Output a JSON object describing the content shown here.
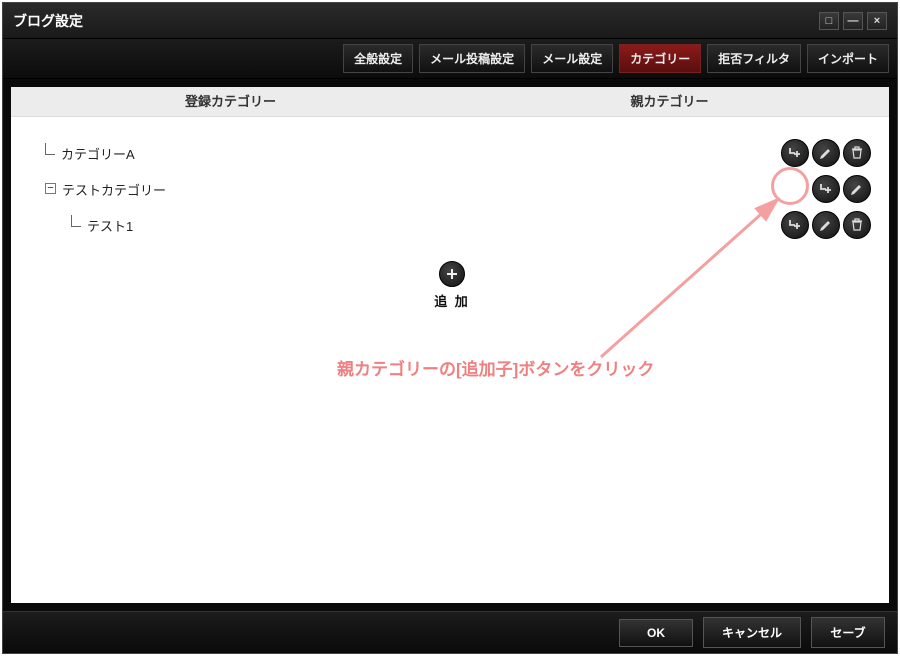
{
  "window": {
    "title": "ブログ設定"
  },
  "tabs": [
    {
      "label": "全般設定",
      "active": false
    },
    {
      "label": "メール投稿設定",
      "active": false
    },
    {
      "label": "メール設定",
      "active": false
    },
    {
      "label": "カテゴリー",
      "active": true
    },
    {
      "label": "拒否フィルタ",
      "active": false
    },
    {
      "label": "インポート",
      "active": false
    }
  ],
  "columns": {
    "left": "登録カテゴリー",
    "right": "親カテゴリー"
  },
  "tree": {
    "rows": [
      {
        "label": "カテゴリーA",
        "indent": 1,
        "has_expander": false,
        "actions": [
          "add-child",
          "edit",
          "delete"
        ]
      },
      {
        "label": "テストカテゴリー",
        "indent": 1,
        "has_expander": true,
        "expander": "−",
        "actions": [
          "add-child",
          "edit"
        ]
      },
      {
        "label": "テスト1",
        "indent": 2,
        "has_expander": false,
        "actions": [
          "add-child",
          "edit",
          "delete"
        ]
      }
    ]
  },
  "add_button": {
    "label": "追 加"
  },
  "annotation": {
    "text": "親カテゴリーの[追加子]ボタンをクリック"
  },
  "footer": {
    "ok": "OK",
    "cancel": "キャンセル",
    "save": "セーブ"
  },
  "icons": {
    "add_child": "add-child-icon",
    "edit": "pencil-icon",
    "delete": "trash-icon",
    "plus": "plus-icon"
  }
}
